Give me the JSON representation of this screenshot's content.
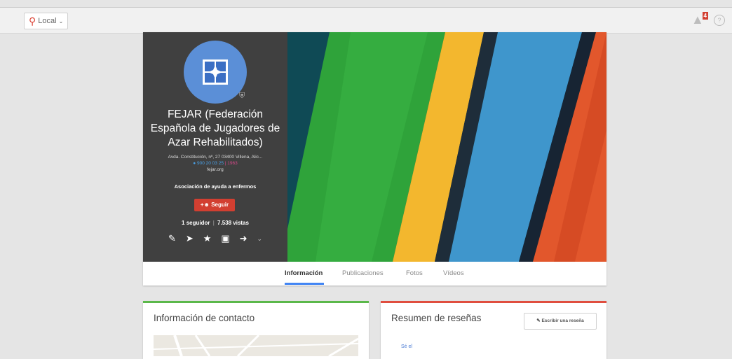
{
  "topbar": {
    "local_label": "Local",
    "notification_count": "4"
  },
  "profile": {
    "name": "FEJAR (Federación Española de Jugadores de Azar Rehabilitados)",
    "address": "Avda. Constitución, nº, 27 03400 Villena, Alic...",
    "phone": "900 20 03 25",
    "phone_suffix": "| 1963",
    "website": "fejar.org",
    "category": "Asociación de ayuda a enfermos",
    "follow_label": "Seguir",
    "followers": "1 seguidor",
    "views": "7.538 vistas",
    "actions": [
      "edit-icon",
      "directions-icon",
      "star-icon",
      "camera-icon",
      "share-icon",
      "chevron-down-icon"
    ],
    "avatar_color": "#5b8fd7"
  },
  "tabs": {
    "items": [
      "Información",
      "Publicaciones",
      "Fotos",
      "Vídeos"
    ],
    "active": "Información"
  },
  "contact": {
    "title": "Información de contacto"
  },
  "reviews": {
    "title": "Resumen de reseñas",
    "write_label": "Escribir una reseña",
    "be_first": "Sé el"
  },
  "colors": {
    "follow_red": "#d23f31",
    "tab_blue": "#4285f4",
    "contact_green": "#5bb84a",
    "review_red": "#e04e3f"
  }
}
